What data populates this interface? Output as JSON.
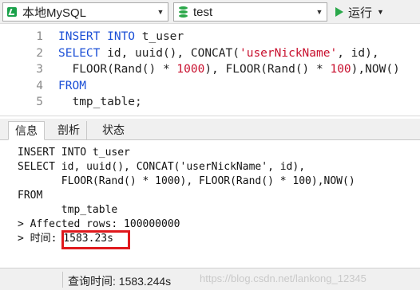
{
  "toolbar": {
    "connection": "本地MySQL",
    "database": "test",
    "run_label": "运行",
    "connection_icon": "connection-icon",
    "database_icon": "database-icon",
    "run_icon": "play-icon",
    "run_color": "#2aa84a"
  },
  "editor": {
    "lines": [
      {
        "num": "1",
        "parts": [
          [
            "kw",
            "INSERT INTO "
          ],
          [
            "pl",
            "t_user"
          ]
        ]
      },
      {
        "num": "2",
        "parts": [
          [
            "kw",
            "SELECT "
          ],
          [
            "pl",
            "id, uuid(), CONCAT("
          ],
          [
            "str",
            "'userNickName'"
          ],
          [
            "pl",
            ", id),"
          ]
        ]
      },
      {
        "num": "3",
        "parts": [
          [
            "pl",
            "  FLOOR(Rand() * "
          ],
          [
            "num",
            "1000"
          ],
          [
            "pl",
            "), FLOOR(Rand() * "
          ],
          [
            "num",
            "100"
          ],
          [
            "pl",
            "),NOW()"
          ]
        ]
      },
      {
        "num": "4",
        "parts": [
          [
            "kw",
            "FROM"
          ]
        ]
      },
      {
        "num": "5",
        "parts": [
          [
            "pl",
            "  tmp_table;"
          ]
        ]
      }
    ]
  },
  "tabs": [
    {
      "label": "信息",
      "active": true
    },
    {
      "label": "剖析",
      "active": false
    },
    {
      "label": "状态",
      "active": false
    }
  ],
  "output": {
    "lines": [
      "INSERT INTO t_user",
      "SELECT id, uuid(), CONCAT('userNickName', id),",
      "       FLOOR(Rand() * 1000), FLOOR(Rand() * 100),NOW()",
      "FROM",
      "       tmp_table",
      "> Affected rows: 100000000",
      "> 时间: 1583.23s"
    ]
  },
  "status": {
    "query_time": "查询时间: 1583.244s",
    "watermark": "https://blog.csdn.net/lankong_12345"
  }
}
